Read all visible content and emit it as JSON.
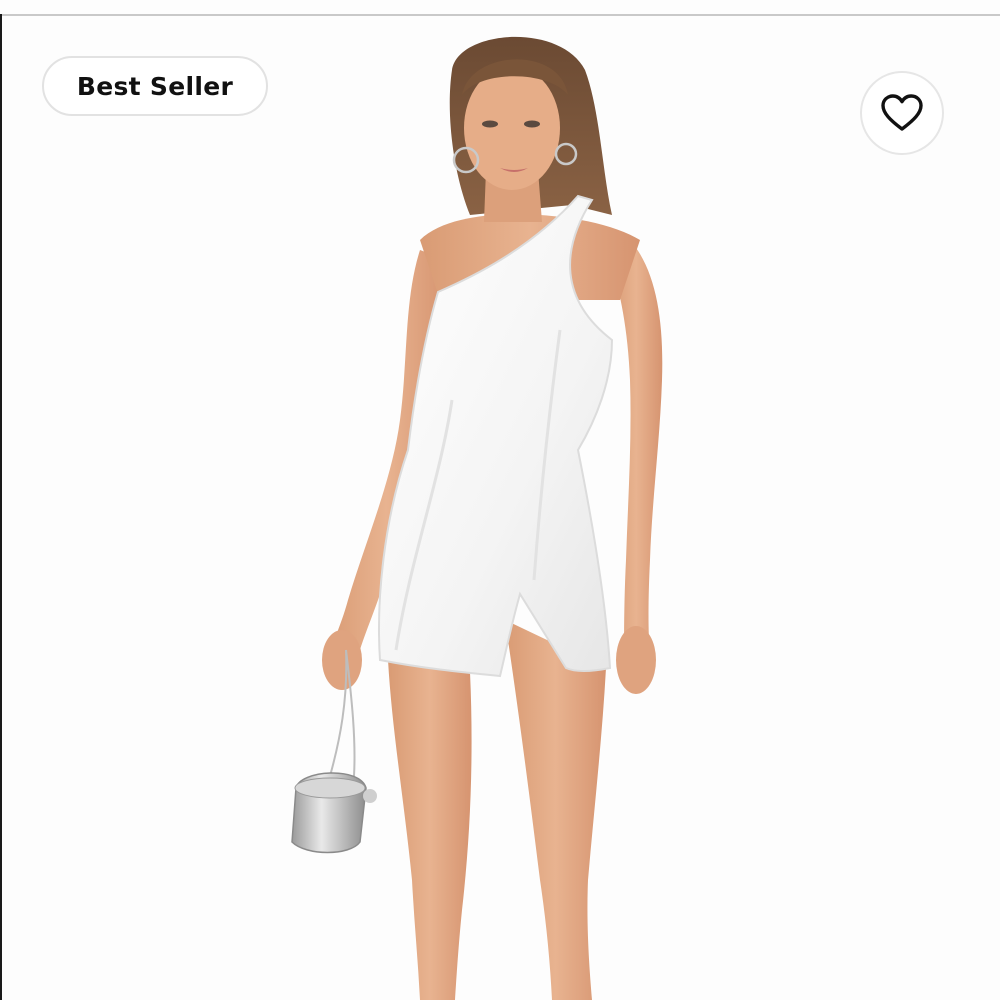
{
  "listing": {
    "badge_label": "Best Seller",
    "like_icon": "heart-outline-icon",
    "photo": {
      "subject": "model",
      "garment_color": "#ffffff",
      "background_color": "#fdfdfd"
    }
  }
}
